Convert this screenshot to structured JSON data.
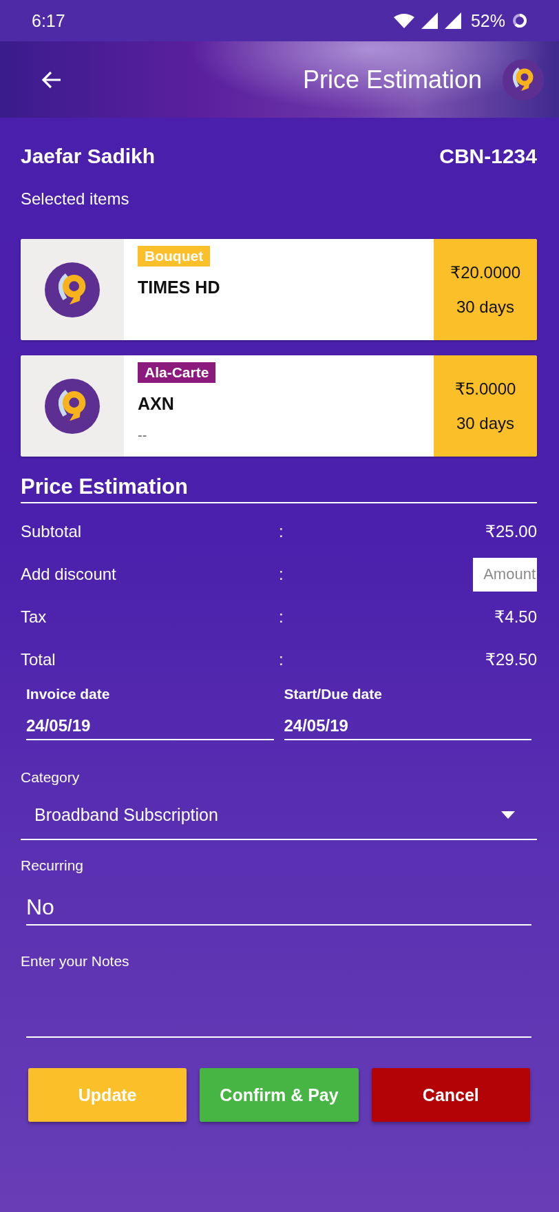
{
  "status_bar": {
    "time": "6:17",
    "battery_percent": "52%"
  },
  "header": {
    "title": "Price Estimation"
  },
  "customer": {
    "name": "Jaefar Sadikh",
    "id": "CBN-1234"
  },
  "selected_items": {
    "label": "Selected items",
    "items": [
      {
        "tag": "Bouquet",
        "color": "#fbbf2a",
        "name": "TIMES HD",
        "price": "₹20.0000",
        "duration": "30 days"
      },
      {
        "tag": "Ala-Carte",
        "color": "#8c1a7c",
        "name": "AXN",
        "note": "--",
        "price": "₹5.0000",
        "duration": "30 days"
      }
    ]
  },
  "price_estimation": {
    "title": "Price Estimation",
    "rows": [
      {
        "kind": "value",
        "label": "Subtotal",
        "separator": ":",
        "value": "₹25.00"
      },
      {
        "kind": "input",
        "label": "Add discount",
        "separator": ":",
        "placeholder": "Amount"
      },
      {
        "kind": "value",
        "label": "Tax",
        "separator": ":",
        "value": "₹4.50"
      },
      {
        "kind": "value",
        "label": "Total",
        "separator": ":",
        "value": "₹29.50"
      }
    ]
  },
  "dates": [
    {
      "label": "Invoice date",
      "value": "24/05/19"
    },
    {
      "label": "Start/Due date",
      "value": "24/05/19"
    }
  ],
  "category": {
    "label": "Category",
    "value": "Broadband Subscription"
  },
  "recurring": {
    "label": "Recurring",
    "value": "No"
  },
  "notes": {
    "label": "Enter your Notes"
  },
  "buttons": [
    {
      "label": "Update",
      "color": "#fbbf2a"
    },
    {
      "label": "Confirm & Pay",
      "color": "#47b544"
    },
    {
      "label": "Cancel",
      "color": "#b30306"
    }
  ]
}
